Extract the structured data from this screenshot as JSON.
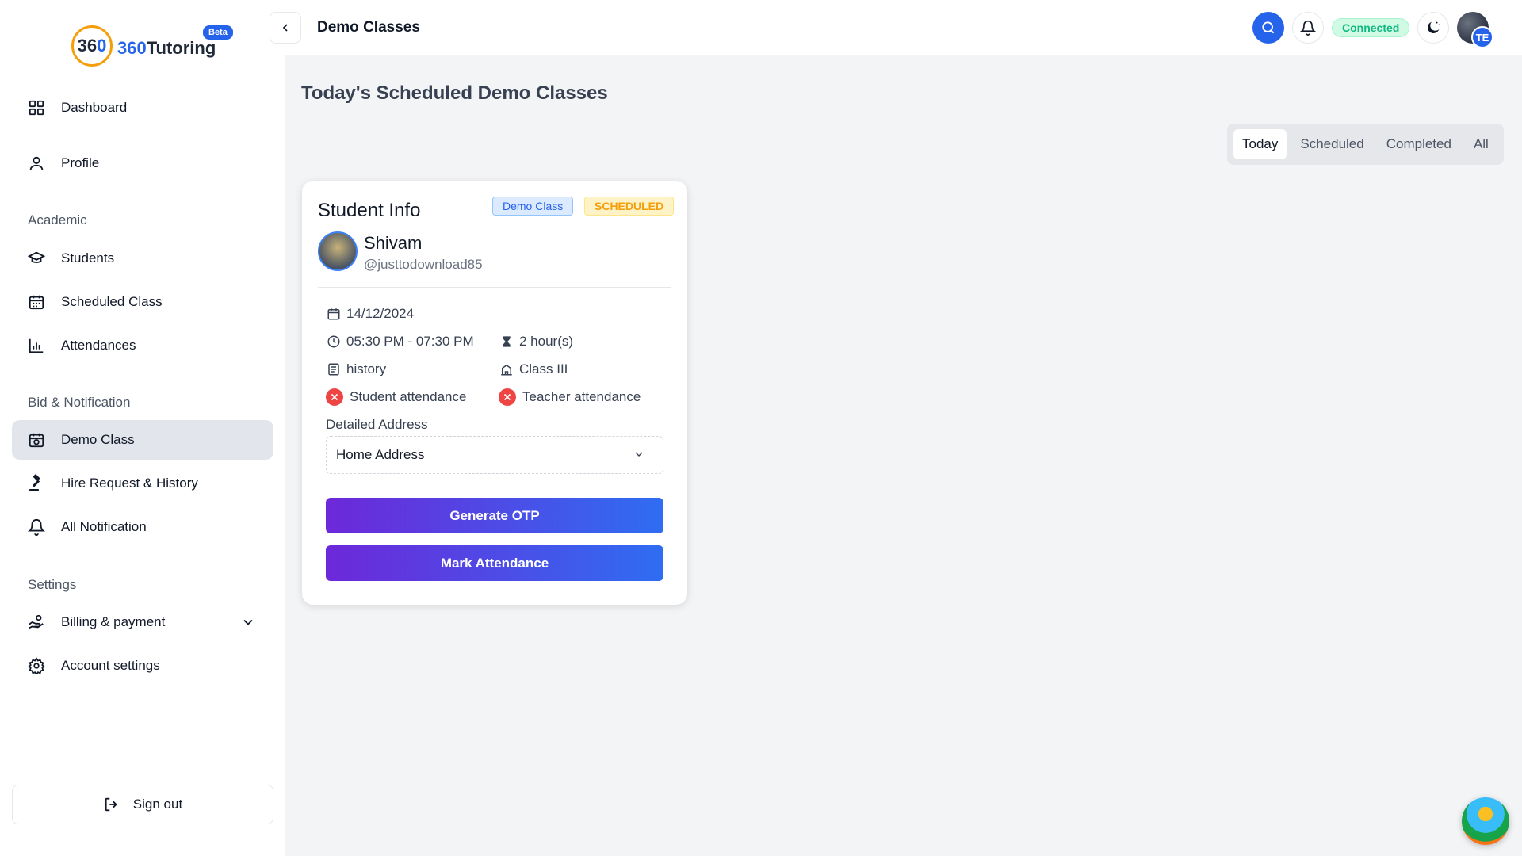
{
  "brand": {
    "logo_mark_prefix": "36",
    "logo_mark_suffix": "0",
    "name_prefix": "360",
    "name_suffix": "Tutoring",
    "beta": "Beta"
  },
  "sidebar": {
    "items": [
      {
        "label": "Dashboard",
        "icon": "grid-icon"
      },
      {
        "label": "Profile",
        "icon": "user-icon"
      },
      {
        "label": "Students",
        "icon": "graduation-cap-icon"
      },
      {
        "label": "Scheduled Class",
        "icon": "calendar-icon"
      },
      {
        "label": "Attendances",
        "icon": "bar-chart-icon"
      },
      {
        "label": "Demo Class",
        "icon": "calendar-badge-icon",
        "active": true
      },
      {
        "label": "Hire Request & History",
        "icon": "gavel-icon"
      },
      {
        "label": "All Notification",
        "icon": "bell-icon"
      },
      {
        "label": "Billing & payment",
        "icon": "hand-coin-icon"
      },
      {
        "label": "Account settings",
        "icon": "gear-icon"
      }
    ],
    "sections": {
      "academic": "Academic",
      "bid": "Bid & Notification",
      "settings": "Settings"
    },
    "signout": "Sign out"
  },
  "topbar": {
    "title": "Demo Classes",
    "status": "Connected",
    "avatar_initials": "TE"
  },
  "main": {
    "title": "Today's Scheduled Demo Classes",
    "tabs": [
      {
        "label": "Today",
        "active": true
      },
      {
        "label": "Scheduled"
      },
      {
        "label": "Completed"
      },
      {
        "label": "All"
      }
    ]
  },
  "card": {
    "title": "Student Info",
    "badge_type": "Demo Class",
    "badge_status": "SCHEDULED",
    "student_name": "Shivam",
    "student_handle": "@justtodownload85",
    "date": "14/12/2024",
    "time": "05:30 PM - 07:30 PM",
    "duration": "2 hour(s)",
    "subject": "history",
    "class": "Class III",
    "student_attendance": "Student attendance",
    "teacher_attendance": "Teacher attendance",
    "address_label": "Detailed Address",
    "address_value": "Home Address",
    "btn_otp": "Generate OTP",
    "btn_attendance": "Mark Attendance"
  },
  "colors": {
    "accent": "#2563eb",
    "connected_bg": "#d1fae5",
    "connected_text": "#10b981",
    "scheduled": "#f59e0b",
    "danger": "#ef4444"
  }
}
